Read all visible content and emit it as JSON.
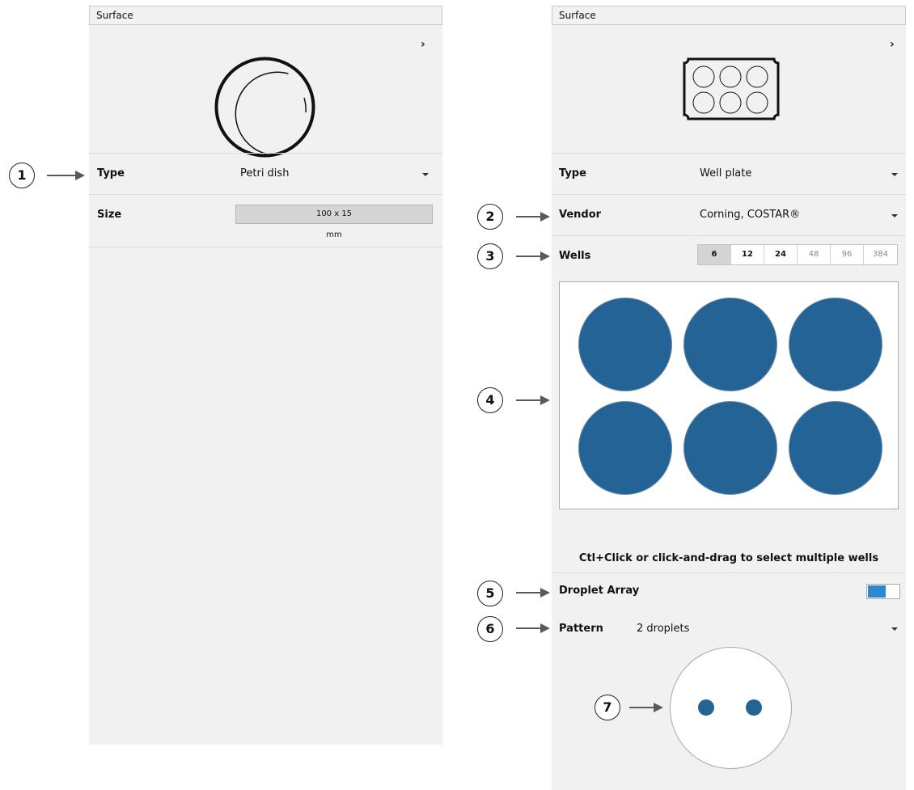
{
  "left_panel": {
    "header": "Surface",
    "type_label": "Type",
    "type_value": "Petri dish",
    "size_label": "Size",
    "size_value": "100 x 15",
    "size_unit": "mm"
  },
  "right_panel": {
    "header": "Surface",
    "type_label": "Type",
    "type_value": "Well plate",
    "vendor_label": "Vendor",
    "vendor_value": "Corning, COSTAR®",
    "wells_label": "Wells",
    "well_options": [
      "6",
      "12",
      "24",
      "48",
      "96",
      "384"
    ],
    "selected_well_option": "6",
    "hint": "Ctl+Click or click-and-drag to select multiple wells",
    "droplet_array_label": "Droplet Array",
    "droplet_array_enabled": true,
    "pattern_label": "Pattern",
    "pattern_value": "2 droplets"
  },
  "callouts": [
    "1",
    "2",
    "3",
    "4",
    "5",
    "6",
    "7"
  ],
  "colors": {
    "panel_bg": "#f0f1f0",
    "well_fill": "#236396",
    "toggle_on": "#2f86d3"
  },
  "icons": {
    "expand": "chevron-right-icon",
    "dropdown": "caret-down-icon",
    "petri_dish": "petri-dish-icon",
    "well_plate": "well-plate-icon"
  }
}
